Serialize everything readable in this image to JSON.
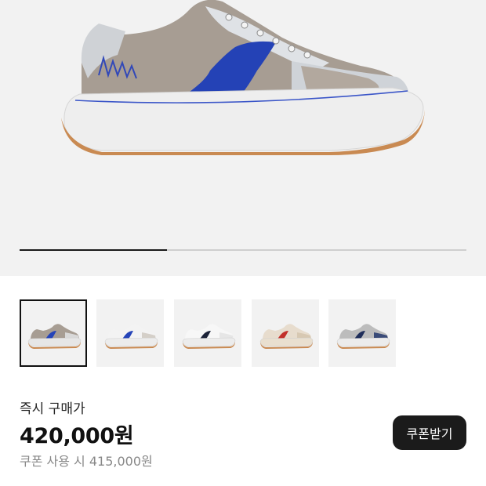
{
  "gallery": {
    "image_alt": "sneaker-main-image",
    "progress_fraction": 0.33,
    "thumbnails": [
      {
        "name": "gray-blue",
        "upper": "#a79d93",
        "accent": "#2544b8",
        "toe": "#d9d9d9",
        "sole": "#e6e6e6",
        "outsole": "#c98a52",
        "selected": true
      },
      {
        "name": "white-blue",
        "upper": "#f3f3f3",
        "accent": "#2544b8",
        "toe": "#d4cfc8",
        "sole": "#ececec",
        "outsole": "#c98a52",
        "selected": false
      },
      {
        "name": "white-navy",
        "upper": "#f7f7f7",
        "accent": "#1c2338",
        "toe": "#e6e6e6",
        "sole": "#ececec",
        "outsole": "#c98a52",
        "selected": false
      },
      {
        "name": "beige-red",
        "upper": "#e7dccd",
        "accent": "#c2302a",
        "toe": "#d7c8b2",
        "sole": "#e9dfcf",
        "outsole": "#c98a52",
        "selected": false
      },
      {
        "name": "navy-gray",
        "upper": "#bcbcbc",
        "accent": "#1f2e5a",
        "toe": "#3a4b78",
        "sole": "#ececec",
        "outsole": "#c98a52",
        "selected": false
      }
    ]
  },
  "price": {
    "label": "즉시 구매가",
    "value": "420,000원",
    "coupon_note": "쿠폰 사용 시 415,000원"
  },
  "coupon_button": {
    "label": "쿠폰받기"
  }
}
